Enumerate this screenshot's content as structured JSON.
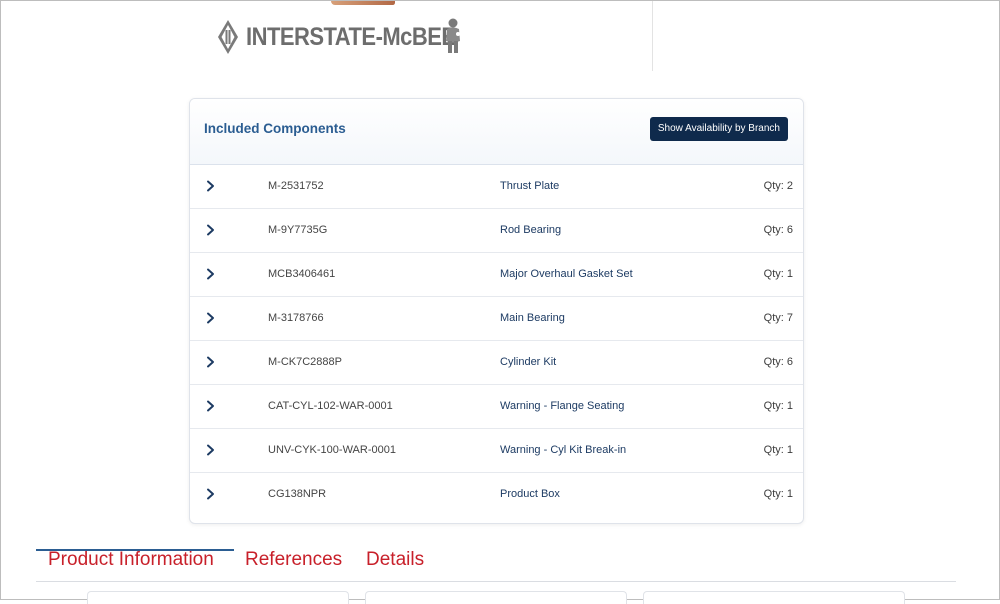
{
  "brand": {
    "logo_text": "INTERSTATE-McBEE"
  },
  "components": {
    "title": "Included Components",
    "availability_button": "Show Availability by Branch",
    "items": [
      {
        "part": "M-2531752",
        "description": "Thrust Plate",
        "qty": "Qty: 2"
      },
      {
        "part": "M-9Y7735G",
        "description": "Rod Bearing",
        "qty": "Qty: 6"
      },
      {
        "part": "MCB3406461",
        "description": "Major Overhaul Gasket Set",
        "qty": "Qty: 1"
      },
      {
        "part": "M-3178766",
        "description": "Main Bearing",
        "qty": "Qty: 7"
      },
      {
        "part": "M-CK7C2888P",
        "description": "Cylinder Kit",
        "qty": "Qty: 6"
      },
      {
        "part": "CAT-CYL-102-WAR-0001",
        "description": "Warning - Flange Seating",
        "qty": "Qty: 1"
      },
      {
        "part": "UNV-CYK-100-WAR-0001",
        "description": "Warning - Cyl Kit Break-in",
        "qty": "Qty: 1"
      },
      {
        "part": "CG138NPR",
        "description": "Product Box",
        "qty": "Qty: 1"
      }
    ]
  },
  "tabs": [
    {
      "label": "Product Information",
      "active": true
    },
    {
      "label": "References",
      "active": false
    },
    {
      "label": "Details",
      "active": false
    }
  ],
  "icons": {
    "row_toggle": "chevron-right-icon"
  },
  "colors": {
    "accent": "#2b5d92",
    "button": "#0f2a4c",
    "tab_text": "#c8202a"
  }
}
